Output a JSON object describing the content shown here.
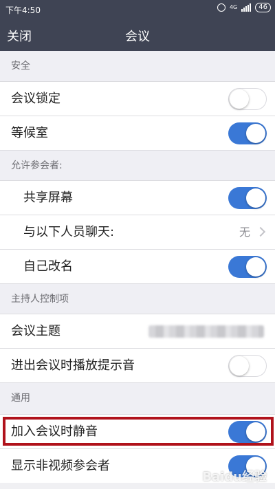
{
  "status_bar": {
    "time": "下午4:50",
    "network": "4G",
    "battery": "46"
  },
  "nav": {
    "back_label": "关闭",
    "title": "会议"
  },
  "sections": {
    "security": {
      "header": "安全"
    },
    "allow": {
      "header": "允许参会者:"
    },
    "host": {
      "header": "主持人控制项"
    },
    "general": {
      "header": "通用"
    }
  },
  "rows": {
    "lock": {
      "label": "会议锁定",
      "on": false
    },
    "waiting_room": {
      "label": "等候室",
      "on": true
    },
    "share_screen": {
      "label": "共享屏幕",
      "on": true
    },
    "chat_with": {
      "label": "与以下人员聊天:",
      "value": "无"
    },
    "rename_self": {
      "label": "自己改名",
      "on": true
    },
    "meeting_topic": {
      "label": "会议主题"
    },
    "entry_chime": {
      "label": "进出会议时播放提示音",
      "on": false
    },
    "mute_on_entry": {
      "label": "加入会议时静音",
      "on": true
    },
    "show_non_video": {
      "label": "显示非视频参会者",
      "on": true
    }
  },
  "watermark": "Baidu经验"
}
